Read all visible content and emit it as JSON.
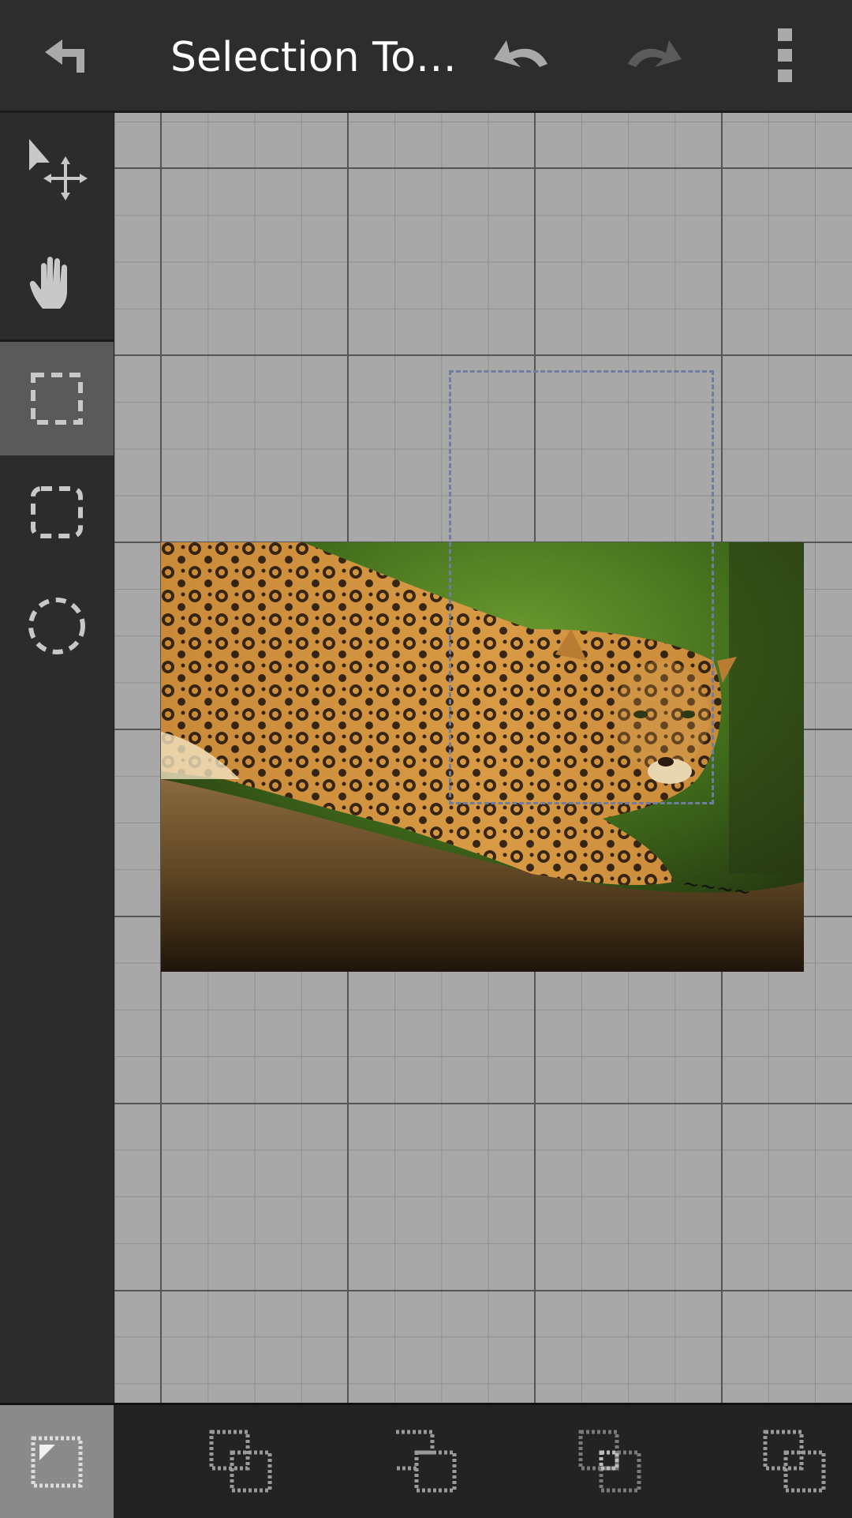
{
  "header": {
    "title": "Selection To…",
    "back_icon": "back-arrow-icon",
    "undo_icon": "undo-icon",
    "redo_icon": "redo-icon",
    "menu_icon": "overflow-menu-icon"
  },
  "tools": [
    {
      "name": "move-select",
      "icon": "pointer-move-icon",
      "active": false
    },
    {
      "name": "hand-pan",
      "icon": "hand-icon",
      "active": false
    },
    {
      "name": "rect-selection",
      "icon": "rectangle-selection-icon",
      "active": true
    },
    {
      "name": "rounded-selection",
      "icon": "rounded-rectangle-selection-icon",
      "active": false
    },
    {
      "name": "ellipse-selection",
      "icon": "ellipse-selection-icon",
      "active": false
    }
  ],
  "bottom_modes": [
    {
      "name": "new-selection",
      "icon": "new-selection-icon",
      "active": true
    },
    {
      "name": "add-selection",
      "icon": "add-selection-icon",
      "active": false
    },
    {
      "name": "subtract-selection",
      "icon": "subtract-selection-icon",
      "active": false
    },
    {
      "name": "intersect-selection",
      "icon": "intersect-selection-icon",
      "active": false
    },
    {
      "name": "xor-selection",
      "icon": "xor-selection-icon",
      "active": false
    }
  ],
  "colors": {
    "toolbar_bg": "#2d2d2d",
    "canvas_bg": "#a8a8a8",
    "grid_minor": "#8e8e8e",
    "grid_major": "#555555",
    "active_tool_bg": "#5a5a5a",
    "selection_marquee": "#6e7da0"
  }
}
